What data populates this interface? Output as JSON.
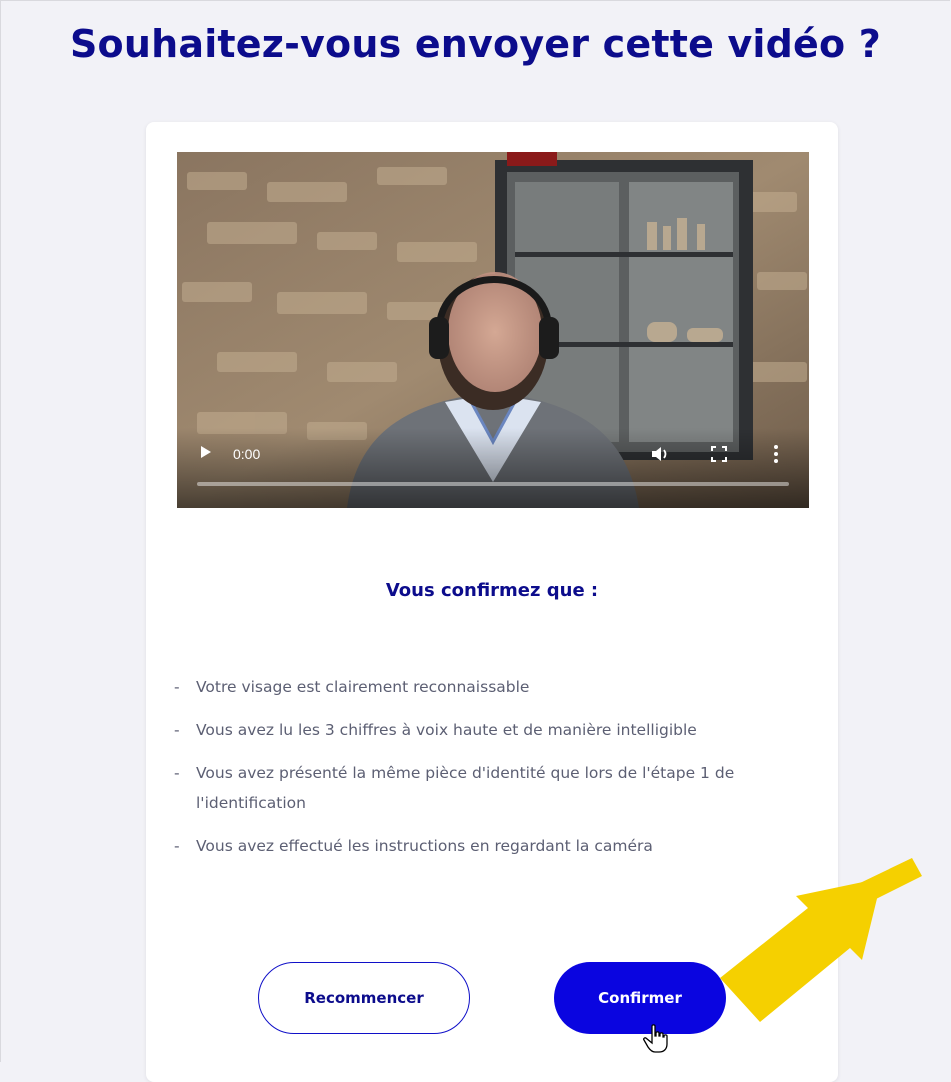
{
  "title": "Souhaitez-vous envoyer cette vidéo ?",
  "video": {
    "time": "0:00",
    "progress_fraction": 0,
    "icons": [
      "play-icon",
      "volume-icon",
      "fullscreen-icon",
      "more-options-icon"
    ]
  },
  "confirm_section": {
    "heading": "Vous confirmez que :",
    "items": [
      "Votre visage est clairement reconnaissable",
      "Vous avez lu les 3 chiffres à voix haute et de manière intelligible",
      "Vous avez présenté la même pièce d'identité que lors de l'étape 1 de l'identification",
      "Vous avez effectué les instructions en regardant la caméra"
    ]
  },
  "buttons": {
    "restart_label": "Recommencer",
    "confirm_label": "Confirmer"
  },
  "colors": {
    "primary": "#0a05e0",
    "title": "#0c0c8c",
    "annotation_arrow": "#f5d000"
  }
}
